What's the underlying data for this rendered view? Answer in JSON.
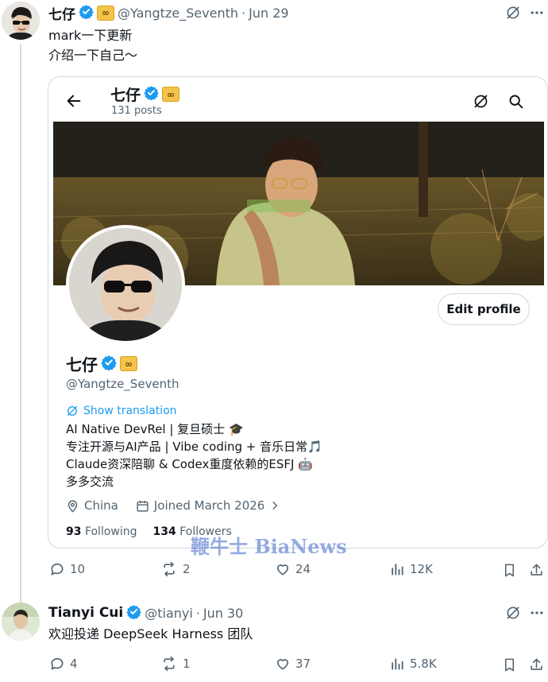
{
  "tweet1": {
    "author_name": "七仔",
    "badge_text": "∞",
    "handle": "@Yangtze_Seventh",
    "separator": "·",
    "date": "Jun 29",
    "text_line1": "mark一下更新",
    "text_line2": "介绍一下自己～",
    "actions": {
      "replies": "10",
      "retweets": "2",
      "likes": "24",
      "views": "12K"
    }
  },
  "profile_card": {
    "header_name": "七仔",
    "post_count": "131 posts",
    "edit_button": "Edit profile",
    "name": "七仔",
    "handle": "@Yangtze_Seventh",
    "show_translation": "Show translation",
    "bio_line1": "AI Native DevRel | 复旦硕士 🎓",
    "bio_line2": "专注开源与AI产品 | Vibe coding + 音乐日常🎵",
    "bio_line3": "Claude资深陪聊 & Codex重度依赖的ESFJ 🤖",
    "bio_line4": "多多交流",
    "location": "China",
    "joined": "Joined March 2026",
    "following_count": "93",
    "following_label": "Following",
    "followers_count": "134",
    "followers_label": "Followers"
  },
  "watermark": "鞭牛士 BiaNews",
  "tweet2": {
    "author_name": "Tianyi Cui",
    "handle": "@tianyi",
    "separator": "·",
    "date": "Jun 30",
    "text": "欢迎投递 DeepSeek Harness 团队",
    "actions": {
      "replies": "4",
      "retweets": "1",
      "likes": "37",
      "views": "5.8K"
    }
  },
  "colors": {
    "verified": "#1d9bf0",
    "muted": "#536471",
    "border": "#cfd9de",
    "link": "#1d9bf0"
  }
}
